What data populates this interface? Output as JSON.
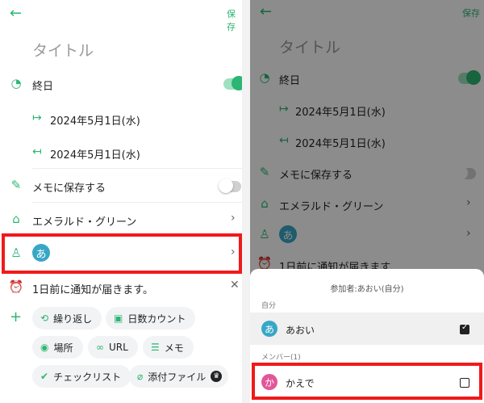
{
  "left": {
    "back_icon": "arrow-left",
    "save_label": "保存",
    "title_placeholder": "タイトル",
    "allday_label": "終日",
    "start_date": "2024年5月1日(水)",
    "end_date": "2024年5月1日(水)",
    "memo_label": "メモに保存する",
    "color_label": "エメラルド・グリーン",
    "participant_avatar": "あ",
    "notify_label": "1日前に通知が届きます。",
    "chips": {
      "repeat": "繰り返し",
      "daycount": "日数カウント",
      "place": "場所",
      "url": "URL",
      "memo": "メモ",
      "checklist": "チェックリスト",
      "attachment": "添付ファイル"
    }
  },
  "right": {
    "save_label": "保存",
    "title_placeholder": "タイトル",
    "allday_label": "終日",
    "start_date": "2024年5月1日(水)",
    "end_date": "2024年5月1日(水)",
    "memo_label": "メモに保存する",
    "color_label": "エメラルド・グリーン",
    "participant_avatar": "あ",
    "notify_label": "1日前に通知が届きます",
    "sheet": {
      "title": "参加者:あおい(自分)",
      "section_self": "自分",
      "self_avatar": "あ",
      "self_name": "あおい",
      "section_members": "メンバー(1)",
      "member_avatar": "か",
      "member_name": "かえで"
    }
  },
  "colors": {
    "accent": "#2bb673",
    "highlight": "#f01a1a",
    "avatar_blue": "#37a7c6",
    "avatar_pink": "#e2579a"
  }
}
